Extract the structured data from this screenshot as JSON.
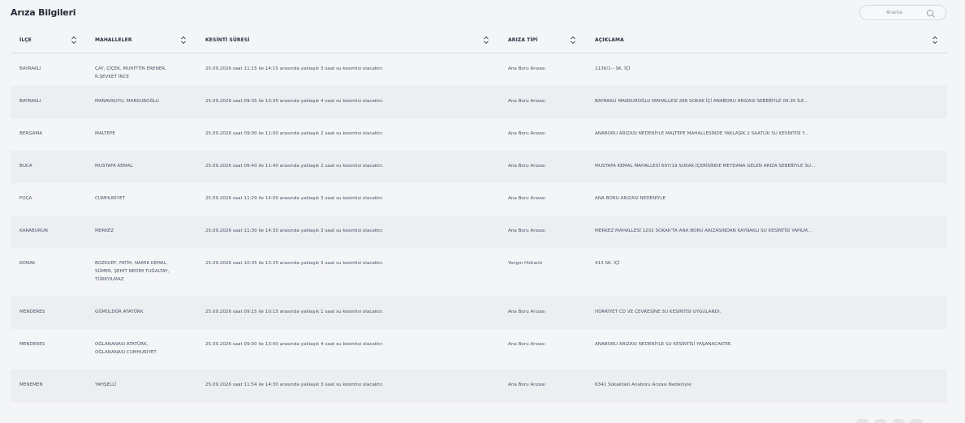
{
  "page": {
    "title": "Arıza Bilgileri"
  },
  "search": {
    "placeholder": "Arama"
  },
  "columns": [
    "İLÇE",
    "MAHALLELER",
    "KESİNTİ SÜRESİ",
    "ARIZA TİPİ",
    "AÇIKLAMA"
  ],
  "rows": [
    {
      "district": "BAYRAKLI",
      "neighborhoods": "ÇAY, ÇİÇEK, MUHİTTİN ERENER,\nR.ŞEVKET İNCE",
      "duration": "25.09.2026 saat 11:15 ile 14:15 arasında yaklaşık 3 saat su kesintisi olacaktır.",
      "type": "Ana Boru Arızası",
      "description": "2136/1-- SK. İÇİ"
    },
    {
      "district": "BAYRAKLI",
      "neighborhoods": "MANAVKUYU, MANSUROĞLU",
      "duration": "25.09.2026 saat 09:35 ile 13:35 arasında yaklaşık 4 saat su kesintisi olacaktır.",
      "type": "Ana Boru Arızası",
      "description": "BAYRAKLI MANSUROĞLU MAHALLESİ 286 SOKAK İÇİ ANABORU ARIZASI SEBEBİYLE 09:35 İLE..."
    },
    {
      "district": "BERGAMA",
      "neighborhoods": "MALTEPE",
      "duration": "25.09.2026 saat 09:00 ile 11:00 arasında yaklaşık 2 saat su kesintisi olacaktır.",
      "type": "Ana Boru Arızası",
      "description": "ANABORU ARIZASI NEDENİYLE MALTEPE MAHALLESİNDE YAKLAŞIK 2 SAATLİK SU KESİNTİSİ Y..."
    },
    {
      "district": "BUCA",
      "neighborhoods": "MUSTAFA KEMAL",
      "duration": "25.09.2026 saat 09:40 ile 11:40 arasında yaklaşık 2 saat su kesintisi olacaktır.",
      "type": "Ana Boru Arızası",
      "description": "MUSTAFA KEMAL MAHALLESİ 697/19 SOKAK İÇERİSİNDE MEYDANA GELEN ARIZA SEBEBİYLE SU..."
    },
    {
      "district": "FOÇA",
      "neighborhoods": "CUMHURİYET",
      "duration": "25.09.2026 saat 11:29 ile 14:00 arasında yaklaşık 3 saat su kesintisi olacaktır.",
      "type": "Ana Boru Arızası",
      "description": "ANA BORU ARIZASI NEDENİYLE"
    },
    {
      "district": "KARABURUN",
      "neighborhoods": "MERKEZ",
      "duration": "25.09.2026 saat 11:30 ile 14:30 arasında yaklaşık 3 saat su kesintisi olacaktır.",
      "type": "Ana Boru Arızası",
      "description": "MERKEZ MAHALLESİ 1202 SOKAK'TA ANA BORU ARIZASINDAN KAYNAKLI SU KESİNTİSİ YAPILM..."
    },
    {
      "district": "KONAK",
      "neighborhoods": "BOZKURT, FATİH, NAMIK KEMAL,\nSÜMER, ŞEHİT NEDİM TUĞALTAY,\nTÜRKYILMAZ",
      "duration": "25.09.2026 saat 10:35 ile 13:35 arasında yaklaşık 3 saat su kesintisi olacaktır.",
      "type": "Yangın Hidrantı",
      "description": "413 SK. İÇİ"
    },
    {
      "district": "MENDERES",
      "neighborhoods": "GÜMÜLDÜR ATATÜRK",
      "duration": "25.09.2026 saat 09:15 ile 10:15 arasında yaklaşık 1 saat su kesintisi olacaktır.",
      "type": "Ana Boru Arızası",
      "description": "HÜRRİYET CD VE ÇEVRESİNE SU KESİNTİSİ UYGULANDI."
    },
    {
      "district": "MENDERES",
      "neighborhoods": "OĞLANANASI ATATÜRK,\nOĞLANANASI CUMHURİYET",
      "duration": "25.09.2026 saat 09:00 ile 13:00 arasında yaklaşık 4 saat su kesintisi olacaktır.",
      "type": "Ana Boru Arızası",
      "description": "ANABORU ARIZASI NEDENİYLE SU KESİNTİSİ YAŞANACAKTIR."
    },
    {
      "district": "MENEMEN",
      "neighborhoods": "YAHŞELLİ",
      "duration": "25.09.2026 saat 11:54 ile 14:30 arasında yaklaşık 3 saat su kesintisi olacaktır.",
      "type": "Ana Boru Arızası",
      "description": "6341 Sokaktaki Anaboru Arızası Nedeniyle"
    }
  ],
  "icons": {
    "search": "search-icon",
    "sort": "sort-icon"
  },
  "colors": {
    "background": "#f4f5f7",
    "row_alt": "#eceef2",
    "text": "#4a5162",
    "header_text": "#2a3140"
  }
}
